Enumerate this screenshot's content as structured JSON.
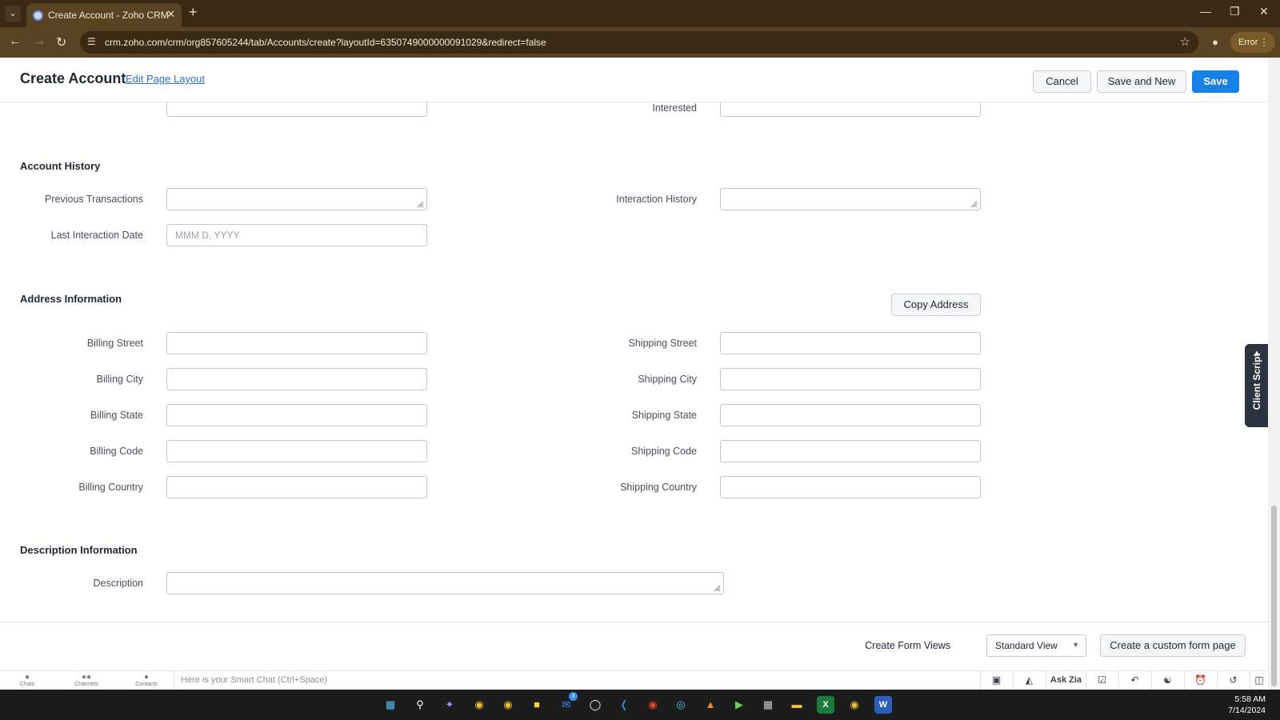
{
  "browser": {
    "tab_title": "Create Account - Zoho CRM",
    "url": "crm.zoho.com/crm/org857605244/tab/Accounts/create?layoutId=6350749000000091029&redirect=false",
    "error_label": "Error"
  },
  "header": {
    "title": "Create Account",
    "edit_layout": "Edit Page Layout",
    "cancel": "Cancel",
    "save_new": "Save and New",
    "save": "Save"
  },
  "form": {
    "partial_label": "Interested",
    "account_history": {
      "title": "Account History",
      "previous_transactions": "Previous Transactions",
      "interaction_history": "Interaction History",
      "last_interaction_date": "Last Interaction Date",
      "date_placeholder": "MMM D, YYYY"
    },
    "address": {
      "title": "Address Information",
      "copy_address": "Copy Address",
      "billing_street": "Billing Street",
      "billing_city": "Billing City",
      "billing_state": "Billing State",
      "billing_code": "Billing Code",
      "billing_country": "Billing Country",
      "shipping_street": "Shipping Street",
      "shipping_city": "Shipping City",
      "shipping_state": "Shipping State",
      "shipping_code": "Shipping Code",
      "shipping_country": "Shipping Country"
    },
    "description": {
      "title": "Description Information",
      "label": "Description"
    },
    "form_views": {
      "label": "Create Form Views",
      "selected": "Standard View",
      "custom_button": "Create a custom form page"
    }
  },
  "client_script": "Client Script",
  "smart_chat": {
    "chats": "Chats",
    "channels": "Channels",
    "contacts": "Contacts",
    "placeholder": "Here is your Smart Chat (Ctrl+Space)",
    "ask_zia": "Ask Zia"
  },
  "taskbar": {
    "time": "5:58 AM",
    "date": "7/14/2024",
    "mail_badge": "3"
  },
  "colors": {
    "primary": "#1580e8",
    "link": "#2a73d0",
    "chrome_dark": "#3a2a14"
  }
}
